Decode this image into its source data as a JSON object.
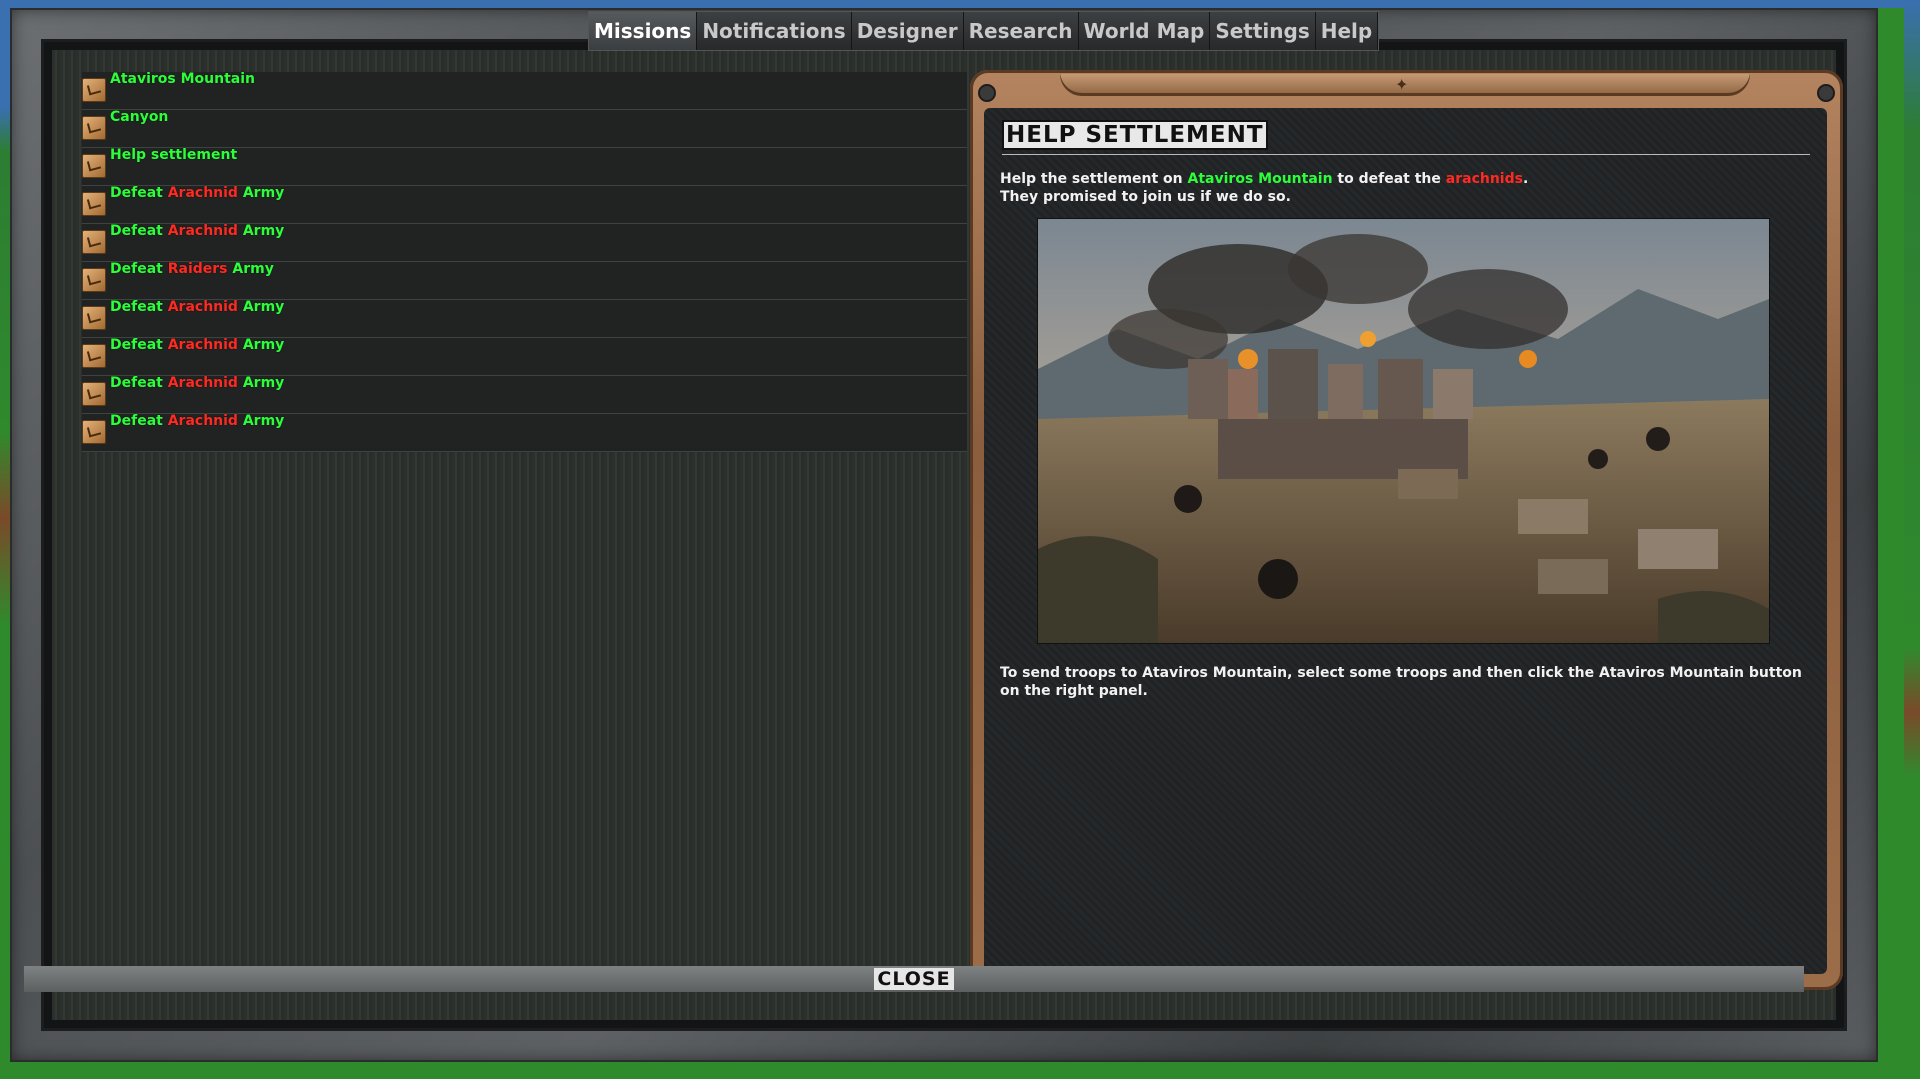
{
  "tabs": [
    {
      "label": "Missions",
      "active": true
    },
    {
      "label": "Notifications"
    },
    {
      "label": "Designer"
    },
    {
      "label": "Research"
    },
    {
      "label": "World Map"
    },
    {
      "label": "Settings"
    },
    {
      "label": "Help"
    }
  ],
  "missions": [
    {
      "parts": [
        {
          "t": "Ataviros Mountain",
          "c": "green"
        }
      ]
    },
    {
      "parts": [
        {
          "t": "Canyon",
          "c": "green"
        }
      ]
    },
    {
      "parts": [
        {
          "t": "Help settlement",
          "c": "green"
        }
      ]
    },
    {
      "parts": [
        {
          "t": "Defeat ",
          "c": "green"
        },
        {
          "t": "Arachnid",
          "c": "red"
        },
        {
          "t": " Army",
          "c": "green"
        }
      ]
    },
    {
      "parts": [
        {
          "t": "Defeat ",
          "c": "green"
        },
        {
          "t": "Arachnid",
          "c": "red"
        },
        {
          "t": " Army",
          "c": "green"
        }
      ]
    },
    {
      "parts": [
        {
          "t": "Defeat ",
          "c": "green"
        },
        {
          "t": "Raiders",
          "c": "red"
        },
        {
          "t": " Army",
          "c": "green"
        }
      ]
    },
    {
      "parts": [
        {
          "t": "Defeat ",
          "c": "green"
        },
        {
          "t": "Arachnid",
          "c": "red"
        },
        {
          "t": " Army",
          "c": "green"
        }
      ]
    },
    {
      "parts": [
        {
          "t": "Defeat ",
          "c": "green"
        },
        {
          "t": "Arachnid",
          "c": "red"
        },
        {
          "t": " Army",
          "c": "green"
        }
      ]
    },
    {
      "parts": [
        {
          "t": "Defeat ",
          "c": "green"
        },
        {
          "t": "Arachnid",
          "c": "red"
        },
        {
          "t": " Army",
          "c": "green"
        }
      ]
    },
    {
      "parts": [
        {
          "t": "Defeat ",
          "c": "green"
        },
        {
          "t": "Arachnid",
          "c": "red"
        },
        {
          "t": " Army",
          "c": "green"
        }
      ]
    }
  ],
  "detail": {
    "title": "HELP SETTLEMENT",
    "intro_1": "Help the settlement on ",
    "intro_place": "Ataviros Mountain",
    "intro_2": " to defeat the ",
    "intro_enemy": "arachnids",
    "intro_3": ".",
    "intro_line2": "They promised to join us if we do so.",
    "instructions": "To send troops to Ataviros Mountain, select some troops and then click the Ataviros Mountain button on the right panel."
  },
  "close_label": "CLOSE",
  "colors": {
    "mission_green": "#2cff3a",
    "enemy_red": "#ff2a22",
    "panel_bronze": "#9c6d49"
  }
}
